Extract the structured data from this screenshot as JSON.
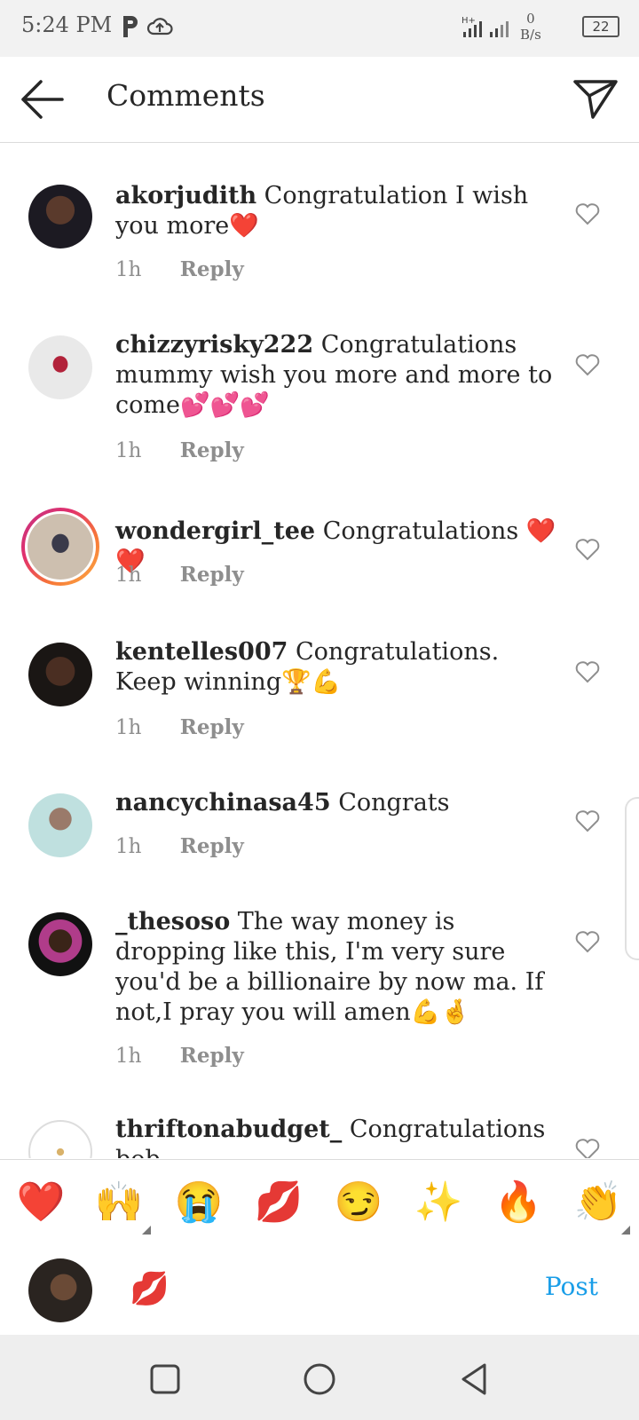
{
  "status_bar": {
    "time": "5:24 PM",
    "network_label": "H+",
    "data_rate_top": "0",
    "data_rate_unit": "B/s",
    "battery": "22"
  },
  "header": {
    "title": "Comments"
  },
  "comments": [
    {
      "username": "akorjudith",
      "text": "Congratulation I wish you more❤️",
      "time": "1h",
      "reply": "Reply"
    },
    {
      "username": "chizzyrisky222",
      "text": "Congratulations mummy wish you more and more to come💕💕💕",
      "time": "1h",
      "reply": "Reply"
    },
    {
      "username": "wondergirl_tee",
      "text": "Congratulations ❤️❤️",
      "time": "1h",
      "reply": "Reply"
    },
    {
      "username": "kentelles007",
      "text": "Congratulations. Keep winning🏆💪",
      "time": "1h",
      "reply": "Reply"
    },
    {
      "username": "nancychinasa45",
      "text": "Congrats",
      "time": "1h",
      "reply": "Reply"
    },
    {
      "username": "_thesoso",
      "text": "The way money is dropping like this, I'm very sure you'd be a billionaire by now ma. If not,I pray you will amen💪🤞",
      "time": "1h",
      "reply": "Reply"
    },
    {
      "username": "thriftonabudget_",
      "text": "Congratulations bob",
      "time": "",
      "reply": ""
    }
  ],
  "emoji_bar": [
    "❤️",
    "🙌",
    "😭",
    "💋",
    "😏",
    "✨",
    "🔥",
    "👏"
  ],
  "composer": {
    "value": "💋",
    "post_label": "Post"
  },
  "colors": {
    "post_blue": "#1a9ee8",
    "meta_gray": "#8e8e8e",
    "text_dark": "#262626"
  }
}
